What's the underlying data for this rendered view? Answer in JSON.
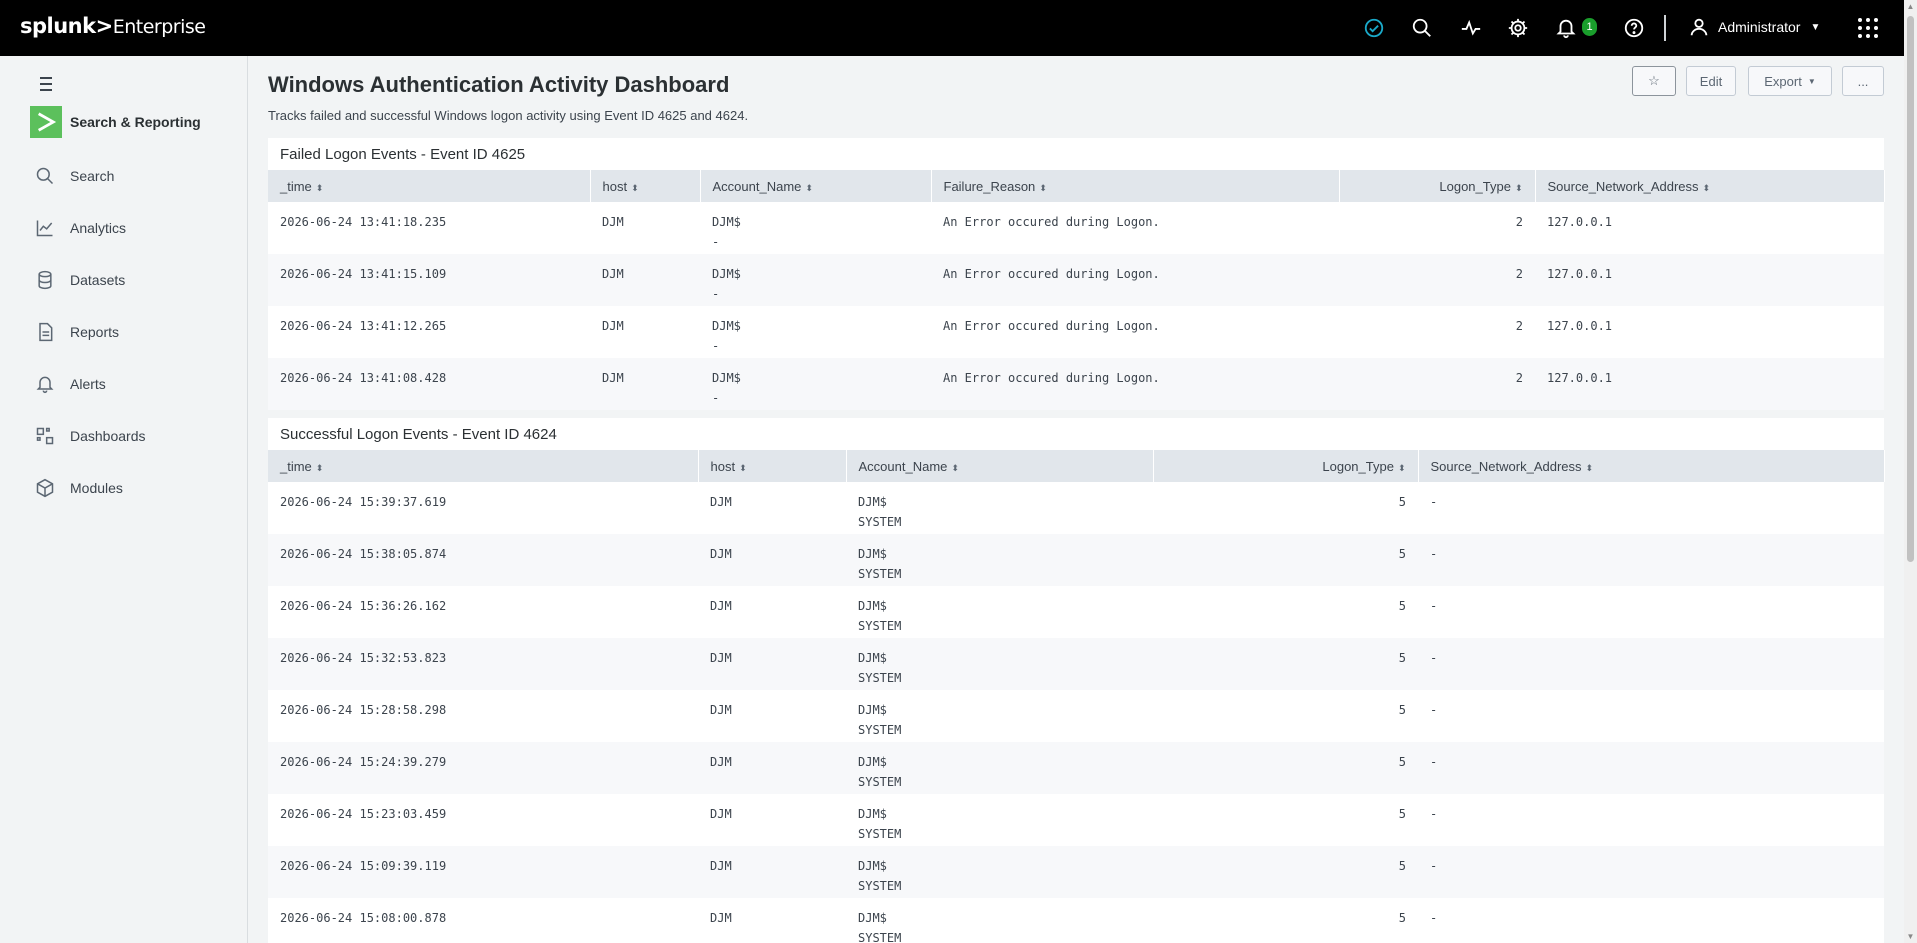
{
  "topbar": {
    "brand_logo": "splunk>",
    "brand_product": "Enterprise",
    "notification_count": "1",
    "user_name": "Administrator",
    "icons": [
      "health-check-icon",
      "search-icon",
      "activity-icon",
      "gear-icon",
      "bell-icon",
      "help-icon",
      "user-icon",
      "apps-grid-icon"
    ]
  },
  "sidebar": {
    "app_name": "Search & Reporting",
    "items": [
      {
        "label": "Search",
        "icon": "search-icon"
      },
      {
        "label": "Analytics",
        "icon": "chart-line-icon"
      },
      {
        "label": "Datasets",
        "icon": "database-icon"
      },
      {
        "label": "Reports",
        "icon": "report-icon"
      },
      {
        "label": "Alerts",
        "icon": "bell-icon"
      },
      {
        "label": "Dashboards",
        "icon": "dashboard-icon"
      },
      {
        "label": "Modules",
        "icon": "cube-icon"
      }
    ]
  },
  "dashboard": {
    "title": "Windows Authentication Activity Dashboard",
    "description": "Tracks failed and successful Windows logon activity using Event ID 4625 and 4624.",
    "buttons": {
      "edit": "Edit",
      "export": "Export",
      "more": "..."
    }
  },
  "failed_panel": {
    "title": "Failed Logon Events - Event ID 4625",
    "columns": [
      "_time",
      "host",
      "Account_Name",
      "Failure_Reason",
      "Logon_Type",
      "Source_Network_Address"
    ],
    "rows": [
      {
        "time": "2026-06-24 13:41:18.235",
        "host": "DJM",
        "account1": "DJM$",
        "account2": "-",
        "reason": "An Error occured during Logon.",
        "logon_type": "2",
        "src": "127.0.0.1"
      },
      {
        "time": "2026-06-24 13:41:15.109",
        "host": "DJM",
        "account1": "DJM$",
        "account2": "-",
        "reason": "An Error occured during Logon.",
        "logon_type": "2",
        "src": "127.0.0.1"
      },
      {
        "time": "2026-06-24 13:41:12.265",
        "host": "DJM",
        "account1": "DJM$",
        "account2": "-",
        "reason": "An Error occured during Logon.",
        "logon_type": "2",
        "src": "127.0.0.1"
      },
      {
        "time": "2026-06-24 13:41:08.428",
        "host": "DJM",
        "account1": "DJM$",
        "account2": "-",
        "reason": "An Error occured during Logon.",
        "logon_type": "2",
        "src": "127.0.0.1"
      }
    ]
  },
  "success_panel": {
    "title": "Successful Logon Events - Event ID 4624",
    "columns": [
      "_time",
      "host",
      "Account_Name",
      "Logon_Type",
      "Source_Network_Address"
    ],
    "rows": [
      {
        "time": "2026-06-24 15:39:37.619",
        "host": "DJM",
        "account1": "DJM$",
        "account2": "SYSTEM",
        "logon_type": "5",
        "src": "-"
      },
      {
        "time": "2026-06-24 15:38:05.874",
        "host": "DJM",
        "account1": "DJM$",
        "account2": "SYSTEM",
        "logon_type": "5",
        "src": "-"
      },
      {
        "time": "2026-06-24 15:36:26.162",
        "host": "DJM",
        "account1": "DJM$",
        "account2": "SYSTEM",
        "logon_type": "5",
        "src": "-"
      },
      {
        "time": "2026-06-24 15:32:53.823",
        "host": "DJM",
        "account1": "DJM$",
        "account2": "SYSTEM",
        "logon_type": "5",
        "src": "-"
      },
      {
        "time": "2026-06-24 15:28:58.298",
        "host": "DJM",
        "account1": "DJM$",
        "account2": "SYSTEM",
        "logon_type": "5",
        "src": "-"
      },
      {
        "time": "2026-06-24 15:24:39.279",
        "host": "DJM",
        "account1": "DJM$",
        "account2": "SYSTEM",
        "logon_type": "5",
        "src": "-"
      },
      {
        "time": "2026-06-24 15:23:03.459",
        "host": "DJM",
        "account1": "DJM$",
        "account2": "SYSTEM",
        "logon_type": "5",
        "src": "-"
      },
      {
        "time": "2026-06-24 15:09:39.119",
        "host": "DJM",
        "account1": "DJM$",
        "account2": "SYSTEM",
        "logon_type": "5",
        "src": "-"
      },
      {
        "time": "2026-06-24 15:08:00.878",
        "host": "DJM",
        "account1": "DJM$",
        "account2": "SYSTEM",
        "logon_type": "5",
        "src": "-"
      }
    ]
  },
  "colors": {
    "topbar": "#000000",
    "app_logo": "#5cc05c",
    "badge": "#1a9e2c",
    "health": "#1aa9c9",
    "header_row": "#e1e6eb"
  }
}
